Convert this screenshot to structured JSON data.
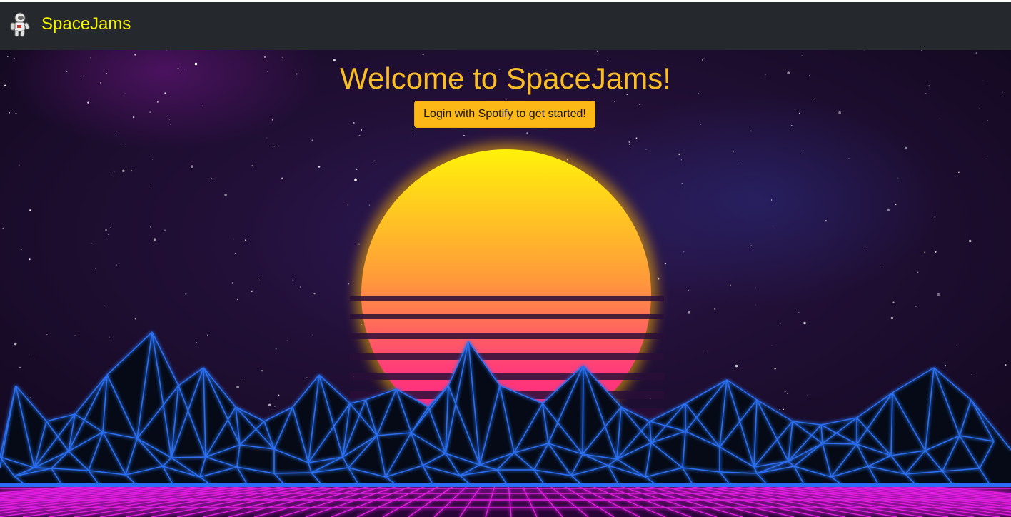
{
  "navbar": {
    "brand_name": "SpaceJams",
    "logo_icon": "astronaut-icon",
    "brand_color": "#f5f500",
    "background_color": "#25292d"
  },
  "hero": {
    "title": "Welcome to SpaceJams!",
    "login_button_label": "Login with Spotify to get started!",
    "title_color": "#fbbd24",
    "button_color": "#fcb817",
    "background_theme": "synthwave sunset over neon wireframe mountains"
  }
}
